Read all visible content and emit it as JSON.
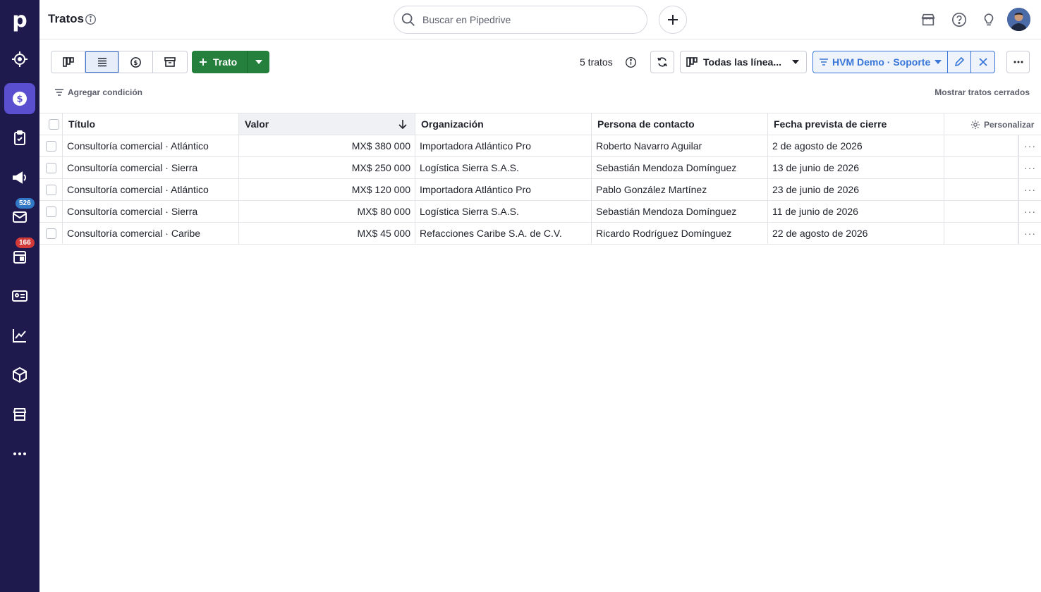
{
  "sidebar": {
    "logo_letter": "p",
    "items": [
      {
        "name": "target-icon",
        "active": false
      },
      {
        "name": "deals-dollar-icon",
        "active": true
      },
      {
        "name": "tasks-clipboard-icon",
        "active": false
      },
      {
        "name": "megaphone-icon",
        "active": false
      },
      {
        "name": "mail-icon",
        "active": false,
        "badge": "526"
      },
      {
        "name": "calendar-icon",
        "active": false,
        "badge": "166"
      },
      {
        "name": "contacts-card-icon",
        "active": false
      },
      {
        "name": "insights-chart-icon",
        "active": false
      },
      {
        "name": "products-box-icon",
        "active": false
      },
      {
        "name": "marketplace-store-icon",
        "active": false
      },
      {
        "name": "more-dots-icon",
        "active": false
      }
    ]
  },
  "header": {
    "title": "Tratos",
    "search_placeholder": "Buscar en Pipedrive"
  },
  "toolbar": {
    "add_deal_label": "Trato",
    "deal_count": "5 tratos",
    "pipeline_label": "Todas las línea...",
    "filter_label": "HVM Demo · Soporte",
    "add_condition_label": "Agregar condición",
    "show_closed_label": "Mostrar tratos cerrados"
  },
  "table": {
    "columns": [
      "Título",
      "Valor",
      "Organización",
      "Persona de contacto",
      "Fecha prevista de cierre"
    ],
    "personalize_label": "Personalizar",
    "rows": [
      {
        "title": "Consultoría comercial · Atlántico",
        "value": "MX$ 380 000",
        "org": "Importadora Atlántico Pro",
        "person": "Roberto Navarro Aguilar",
        "date": "2 de agosto de 2026"
      },
      {
        "title": "Consultoría comercial · Sierra",
        "value": "MX$ 250 000",
        "org": "Logística Sierra S.A.S.",
        "person": "Sebastián Mendoza Domínguez",
        "date": "13 de junio de 2026"
      },
      {
        "title": "Consultoría comercial · Atlántico",
        "value": "MX$ 120 000",
        "org": "Importadora Atlántico Pro",
        "person": "Pablo González Martínez",
        "date": "23 de junio de 2026"
      },
      {
        "title": "Consultoría comercial · Sierra",
        "value": "MX$ 80 000",
        "org": "Logística Sierra S.A.S.",
        "person": "Sebastián Mendoza Domínguez",
        "date": "11 de junio de 2026"
      },
      {
        "title": "Consultoría comercial · Caribe",
        "value": "MX$ 45 000",
        "org": "Refacciones Caribe S.A. de C.V.",
        "person": "Ricardo Rodríguez Domínguez",
        "date": "22 de agosto de 2026"
      }
    ]
  },
  "colors": {
    "sidebar_bg": "#1e1a4d",
    "active_nav": "#5a4fcf",
    "primary_green": "#24803c",
    "filter_blue": "#3875d7"
  }
}
